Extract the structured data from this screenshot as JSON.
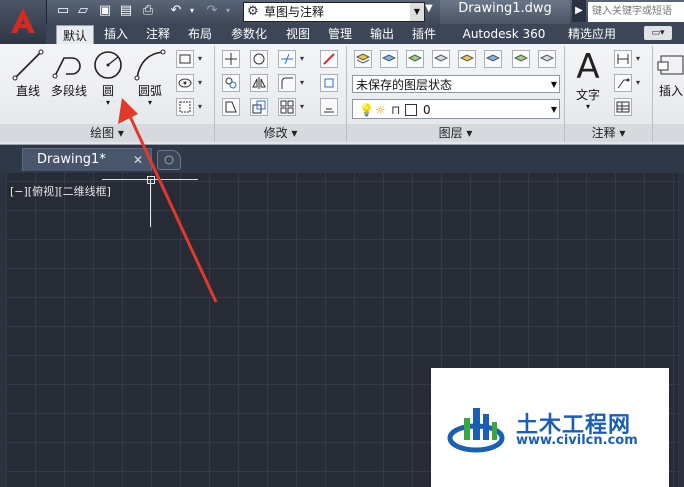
{
  "title_bar": {
    "workspace": "草图与注释",
    "document_title": "Drawing1.dwg",
    "search_placeholder": "键入关键字或短语"
  },
  "ribbon_tabs": [
    "默认",
    "插入",
    "注释",
    "布局",
    "参数化",
    "视图",
    "管理",
    "输出",
    "插件",
    "Autodesk 360",
    "精选应用"
  ],
  "active_tab": "默认",
  "draw_panel": {
    "title": "绘图 ▾",
    "tools": [
      "直线",
      "多段线",
      "圆",
      "圆弧"
    ]
  },
  "modify_panel": {
    "title": "修改 ▾"
  },
  "layer_panel": {
    "title": "图层 ▾",
    "layer_state": "未保存的图层状态",
    "current_layer": "0"
  },
  "annotation_panel": {
    "title": "注释 ▾",
    "text_tool": "文字",
    "insert_tool": "插入"
  },
  "file_tab": {
    "name": "Drawing1*"
  },
  "viewport_label": "[−][俯视][二维线框]",
  "watermark": {
    "name": "土木工程网",
    "url": "www.civilcn.com"
  },
  "colors": {
    "canvas_bg": "#262b36",
    "grid": "#343a47",
    "arrow": "#e23a2a",
    "watermark_blue": "#1a5fb4",
    "watermark_green": "#3aa640"
  }
}
